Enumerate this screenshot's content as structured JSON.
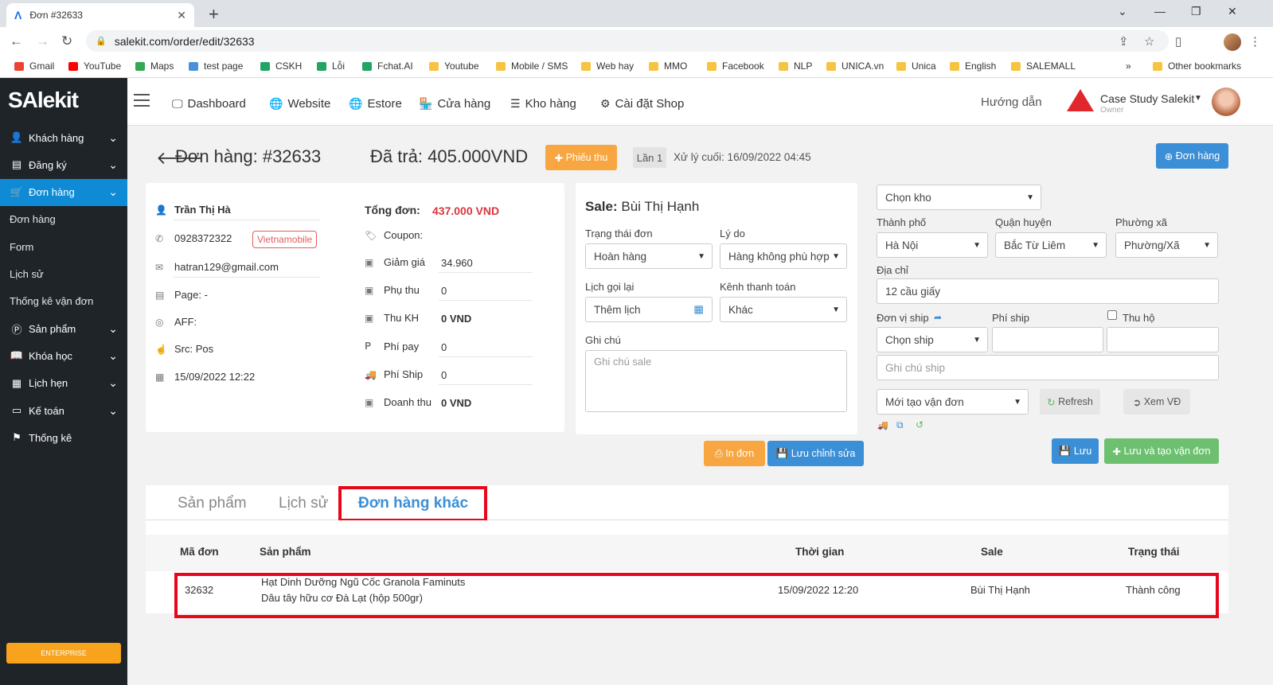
{
  "browser": {
    "tab_title": "Đơn #32633",
    "url": "salekit.com/order/edit/32633",
    "bookmarks": [
      {
        "label": "Gmail",
        "kind": "gmail"
      },
      {
        "label": "YouTube",
        "kind": "youtube"
      },
      {
        "label": "Maps",
        "kind": "maps"
      },
      {
        "label": "test page",
        "kind": "page"
      },
      {
        "label": "CSKH",
        "kind": "sheet"
      },
      {
        "label": "Lỗi",
        "kind": "sheet"
      },
      {
        "label": "Fchat.AI",
        "kind": "sheet"
      },
      {
        "label": "Youtube",
        "kind": "folder"
      },
      {
        "label": "Mobile / SMS",
        "kind": "folder"
      },
      {
        "label": "Web hay",
        "kind": "folder"
      },
      {
        "label": "MMO",
        "kind": "folder"
      },
      {
        "label": "Facebook",
        "kind": "folder"
      },
      {
        "label": "NLP",
        "kind": "folder"
      },
      {
        "label": "UNICA.vn",
        "kind": "folder"
      },
      {
        "label": "Unica",
        "kind": "folder"
      },
      {
        "label": "English",
        "kind": "folder"
      },
      {
        "label": "SALEMALL",
        "kind": "folder"
      }
    ],
    "more": "»",
    "other_bookmarks": "Other bookmarks"
  },
  "sidebar": {
    "logo": "SAlekit",
    "items": [
      {
        "label": "Khách hàng",
        "icon": "user-icon",
        "chevron": true
      },
      {
        "label": "Đăng ký",
        "icon": "card-icon",
        "chevron": true
      },
      {
        "label": "Đơn hàng",
        "icon": "cart-icon",
        "chevron": true,
        "active": true
      },
      {
        "label": "Đơn hàng",
        "sub": true
      },
      {
        "label": "Form",
        "sub": true
      },
      {
        "label": "Lịch sử",
        "sub": true
      },
      {
        "label": "Thống kê vận đơn",
        "sub": true
      },
      {
        "label": "Sản phẩm",
        "icon": "product-icon",
        "chevron": true
      },
      {
        "label": "Khóa học",
        "icon": "book-icon",
        "chevron": true
      },
      {
        "label": "Lịch hẹn",
        "icon": "calendar-icon",
        "chevron": true
      },
      {
        "label": "Kế toán",
        "icon": "accounting-icon",
        "chevron": true
      },
      {
        "label": "Thống kê",
        "icon": "flag-icon",
        "chevron": false
      }
    ],
    "enterprise": "ENTERPRISE"
  },
  "topnav": {
    "items": [
      {
        "label": "Dashboard",
        "icon": "monitor-icon"
      },
      {
        "label": "Website",
        "icon": "globe-icon"
      },
      {
        "label": "Estore",
        "icon": "globe-icon"
      },
      {
        "label": "Cửa hàng",
        "icon": "store-icon"
      },
      {
        "label": "Kho hàng",
        "icon": "stack-icon"
      },
      {
        "label": "Cài đặt Shop",
        "icon": "gear-icon"
      }
    ],
    "guide": "Hướng dẫn",
    "account": "Case Study Salekit",
    "role": "Owner"
  },
  "header": {
    "title": "Đơn hàng: #32633",
    "paid": "Đã trả: 405.000VND",
    "receipt_btn": "Phiếu thu",
    "attempt": "Lần 1",
    "last_processed": "Xử lý cuối: 16/09/2022 04:45",
    "new_order_btn": "Đơn hàng"
  },
  "customer": {
    "name": "Trần Thị Hà",
    "phone": "0928372322",
    "carrier": "Vietnamobile",
    "email": "hatran129@gmail.com",
    "page": "Page: -",
    "aff": "AFF:",
    "src": "Src: Pos",
    "date": "15/09/2022 12:22"
  },
  "totals": {
    "total_label": "Tổng đơn:",
    "total_value": "437.000 VND",
    "coupon_label": "Coupon:",
    "discount_label": "Giảm giá",
    "discount_value": "34.960",
    "surcharge_label": "Phụ thu",
    "surcharge_value": "0",
    "collected_label": "Thu KH",
    "collected_value": "0 VND",
    "payfee_label": "Phí pay",
    "payfee_value": "0",
    "ship_label": "Phí Ship",
    "ship_value": "0",
    "revenue_label": "Doanh thu",
    "revenue_value": "0 VND"
  },
  "sale": {
    "sale_label": "Sale:",
    "sale_name": "Bùi Thị Hạnh",
    "status_label": "Trạng thái đơn",
    "status_value": "Hoàn hàng",
    "reason_label": "Lý do",
    "reason_value": "Hàng không phù hợp",
    "callback_label": "Lịch gọi lại",
    "callback_value": "Thêm lịch",
    "payment_label": "Kênh thanh toán",
    "payment_value": "Khác",
    "note_label": "Ghi chú",
    "note_placeholder": "Ghi chú sale",
    "print_btn": "In đơn",
    "save_edit_btn": "Lưu chỉnh sửa"
  },
  "shipping": {
    "warehouse": "Chọn kho",
    "city_label": "Thành phố",
    "city_value": "Hà Nội",
    "district_label": "Quận huyện",
    "district_value": "Bắc Từ Liêm",
    "ward_label": "Phường xã",
    "ward_value": "Phường/Xã",
    "address_label": "Địa chỉ",
    "address_value": "12 cầu giấy",
    "unit_label": "Đơn vị ship",
    "fee_label": "Phí ship",
    "cod_label": "Thu hộ",
    "unit_value": "Chọn ship",
    "ship_note_placeholder": "Ghi chú ship",
    "waybill_status": "Mới tạo vận đơn",
    "refresh_btn": "Refresh",
    "view_btn": "Xem VĐ",
    "save_btn": "Lưu",
    "save_create_btn": "Lưu và tạo vận đơn"
  },
  "tabs": [
    "Sản phẩm",
    "Lịch sử",
    "Đơn hàng khác"
  ],
  "orders_table": {
    "headers": [
      "Mã đơn",
      "Sản phẩm",
      "Thời gian",
      "Sale",
      "Trạng thái"
    ],
    "rows": [
      {
        "id": "32632",
        "product_line1": "Hạt Dinh Dưỡng Ngũ Cốc Granola Faminuts",
        "product_line2": "Dâu tây hữu cơ Đà Lạt (hộp 500gr)",
        "time": "15/09/2022 12:20",
        "sale": "Bùi Thị Hạnh",
        "status": "Thành công"
      }
    ]
  }
}
